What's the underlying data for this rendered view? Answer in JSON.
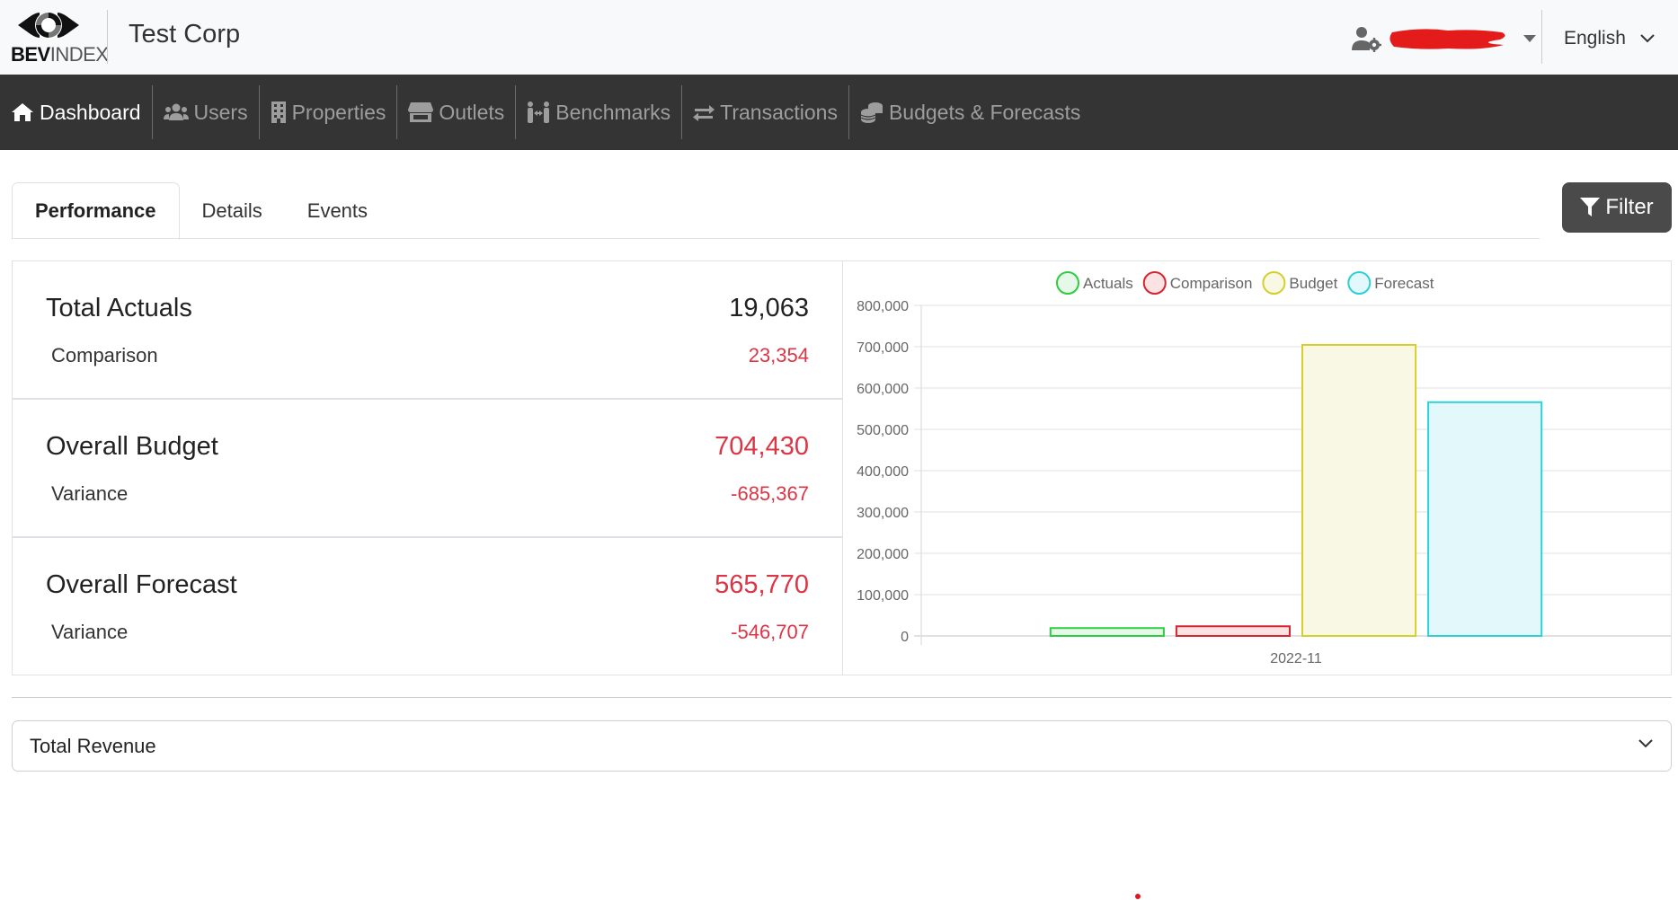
{
  "header": {
    "logo_bold": "BEV",
    "logo_light": "INDEX",
    "company": "Test Corp",
    "user_icon": "user-gear-icon",
    "language": "English"
  },
  "nav": [
    {
      "label": "Dashboard",
      "icon": "home-icon",
      "active": true
    },
    {
      "label": "Users",
      "icon": "users-icon",
      "active": false
    },
    {
      "label": "Properties",
      "icon": "building-icon",
      "active": false
    },
    {
      "label": "Outlets",
      "icon": "store-icon",
      "active": false
    },
    {
      "label": "Benchmarks",
      "icon": "people-arrows-icon",
      "active": false
    },
    {
      "label": "Transactions",
      "icon": "exchange-icon",
      "active": false
    },
    {
      "label": "Budgets & Forecasts",
      "icon": "coins-icon",
      "active": false
    }
  ],
  "tabs": [
    {
      "label": "Performance",
      "active": true
    },
    {
      "label": "Details",
      "active": false
    },
    {
      "label": "Events",
      "active": false
    }
  ],
  "filter_label": "Filter",
  "kpis": [
    {
      "title": "Total Actuals",
      "value": "19,063",
      "value_red": false,
      "sub_label": "Comparison",
      "sub_value": "23,354"
    },
    {
      "title": "Overall Budget",
      "value": "704,430",
      "value_red": true,
      "sub_label": "Variance",
      "sub_value": "-685,367"
    },
    {
      "title": "Overall Forecast",
      "value": "565,770",
      "value_red": true,
      "sub_label": "Variance",
      "sub_value": "-546,707"
    }
  ],
  "chart_data": {
    "type": "bar",
    "title": "",
    "xlabel": "",
    "ylabel": "",
    "categories": [
      "2022-11"
    ],
    "series": [
      {
        "name": "Actuals",
        "values": [
          19063
        ],
        "border": "#2ecc40",
        "fill": "#e6f9e8"
      },
      {
        "name": "Comparison",
        "values": [
          23354
        ],
        "border": "#d9232d",
        "fill": "#fbe3e4"
      },
      {
        "name": "Budget",
        "values": [
          704430
        ],
        "border": "#d4cf2a",
        "fill": "#f9f8e4"
      },
      {
        "name": "Forecast",
        "values": [
          565770
        ],
        "border": "#2dd0d5",
        "fill": "#e2f8fa"
      }
    ],
    "ylim": [
      0,
      800000
    ],
    "yticks": [
      "0",
      "100,000",
      "200,000",
      "300,000",
      "400,000",
      "500,000",
      "600,000",
      "700,000",
      "800,000"
    ],
    "grid": true,
    "legend": "top-center"
  },
  "accordion": {
    "label": "Total Revenue"
  },
  "colors": {
    "nav_bg": "#343434",
    "negative": "#dc3545",
    "filter_bg": "#4a4a4a"
  }
}
